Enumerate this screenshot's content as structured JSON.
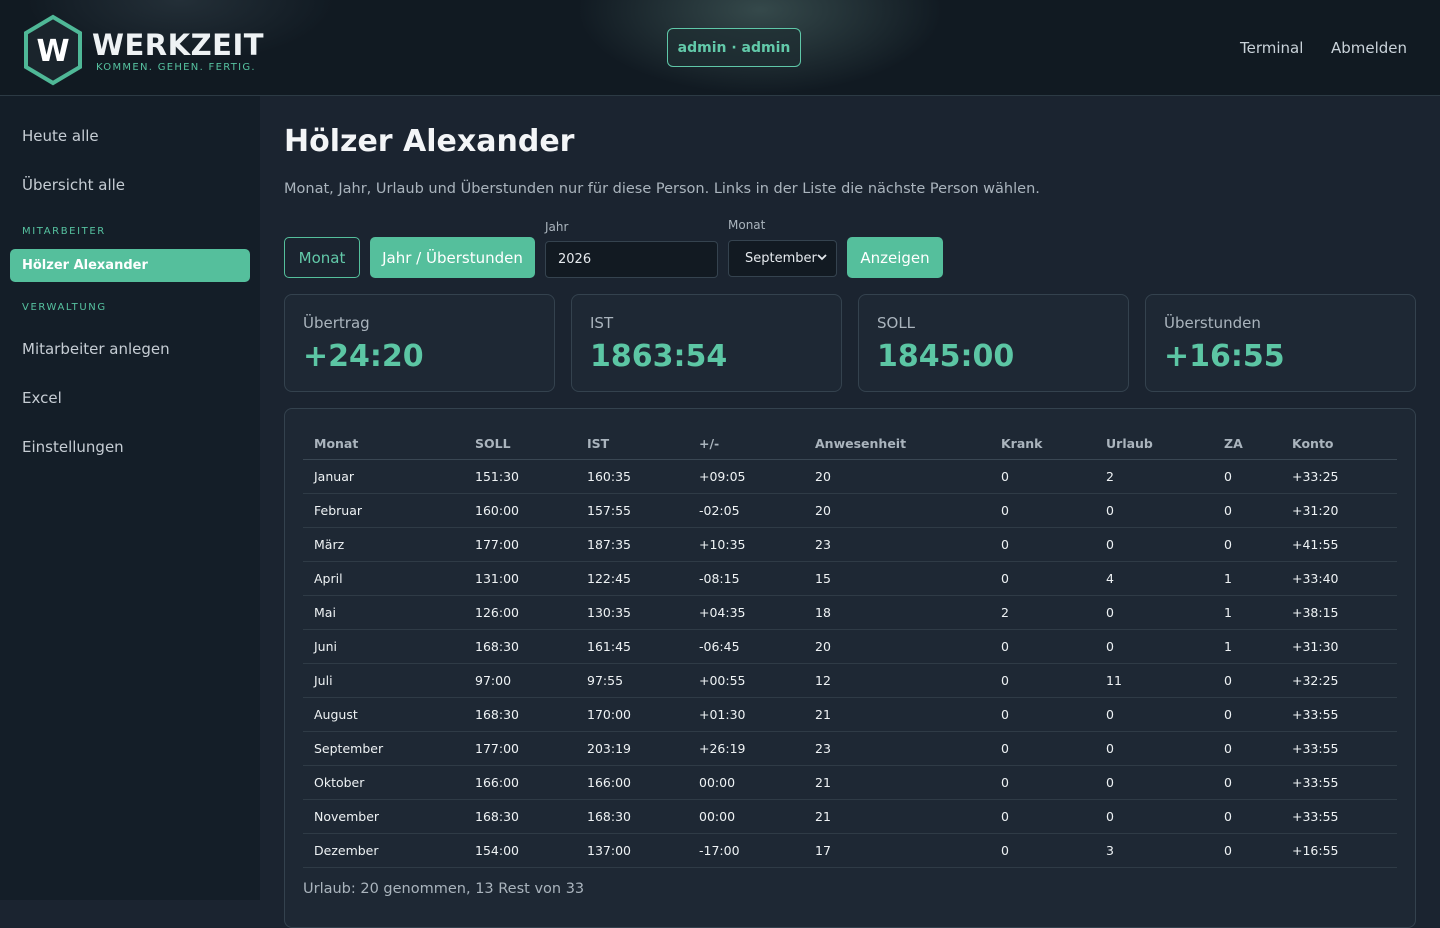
{
  "brand": {
    "name": "WERKZEIT",
    "tagline": "KOMMEN. GEHEN. FERTIG.",
    "letter": "W",
    "accent": "#55bf9c"
  },
  "header": {
    "user": "admin · admin",
    "nav": [
      "Terminal",
      "Abmelden"
    ]
  },
  "sidebar": {
    "top_items": [
      "Heute alle",
      "Übersicht alle"
    ],
    "section_staff": "MITARBEITER",
    "active_employee": "Hölzer Alexander",
    "section_admin": "VERWALTUNG",
    "admin_items": [
      "Mitarbeiter anlegen",
      "Excel",
      "Einstellungen"
    ]
  },
  "page": {
    "title": "Hölzer Alexander",
    "description": "Monat, Jahr, Urlaub und Überstunden nur für diese Person. Links in der Liste die nächste Person wählen."
  },
  "controls": {
    "month_button": "Monat",
    "year_button": "Jahr / Überstunden",
    "year_label": "Jahr",
    "year_value": "2026",
    "month_label": "Monat",
    "month_value": "September",
    "show_button": "Anzeigen"
  },
  "cards": [
    {
      "label": "Übertrag",
      "value": "+24:20"
    },
    {
      "label": "IST",
      "value": "1863:54"
    },
    {
      "label": "SOLL",
      "value": "1845:00"
    },
    {
      "label": "Überstunden",
      "value": "+16:55"
    }
  ],
  "table": {
    "columns": [
      "Monat",
      "SOLL",
      "IST",
      "+/-",
      "Anwesenheit",
      "Krank",
      "Urlaub",
      "ZA",
      "Konto"
    ],
    "rows": [
      [
        "Januar",
        "151:30",
        "160:35",
        "+09:05",
        "20",
        "0",
        "2",
        "0",
        "+33:25"
      ],
      [
        "Februar",
        "160:00",
        "157:55",
        "-02:05",
        "20",
        "0",
        "0",
        "0",
        "+31:20"
      ],
      [
        "März",
        "177:00",
        "187:35",
        "+10:35",
        "23",
        "0",
        "0",
        "0",
        "+41:55"
      ],
      [
        "April",
        "131:00",
        "122:45",
        "-08:15",
        "15",
        "0",
        "4",
        "1",
        "+33:40"
      ],
      [
        "Mai",
        "126:00",
        "130:35",
        "+04:35",
        "18",
        "2",
        "0",
        "1",
        "+38:15"
      ],
      [
        "Juni",
        "168:30",
        "161:45",
        "-06:45",
        "20",
        "0",
        "0",
        "1",
        "+31:30"
      ],
      [
        "Juli",
        "97:00",
        "97:55",
        "+00:55",
        "12",
        "0",
        "11",
        "0",
        "+32:25"
      ],
      [
        "August",
        "168:30",
        "170:00",
        "+01:30",
        "21",
        "0",
        "0",
        "0",
        "+33:55"
      ],
      [
        "September",
        "177:00",
        "203:19",
        "+26:19",
        "23",
        "0",
        "0",
        "0",
        "+33:55"
      ],
      [
        "Oktober",
        "166:00",
        "166:00",
        "00:00",
        "21",
        "0",
        "0",
        "0",
        "+33:55"
      ],
      [
        "November",
        "168:30",
        "168:30",
        "00:00",
        "21",
        "0",
        "0",
        "0",
        "+33:55"
      ],
      [
        "Dezember",
        "154:00",
        "137:00",
        "-17:00",
        "17",
        "0",
        "3",
        "0",
        "+16:55"
      ]
    ]
  },
  "summary": "Urlaub: 20 genommen, 13 Rest von 33"
}
